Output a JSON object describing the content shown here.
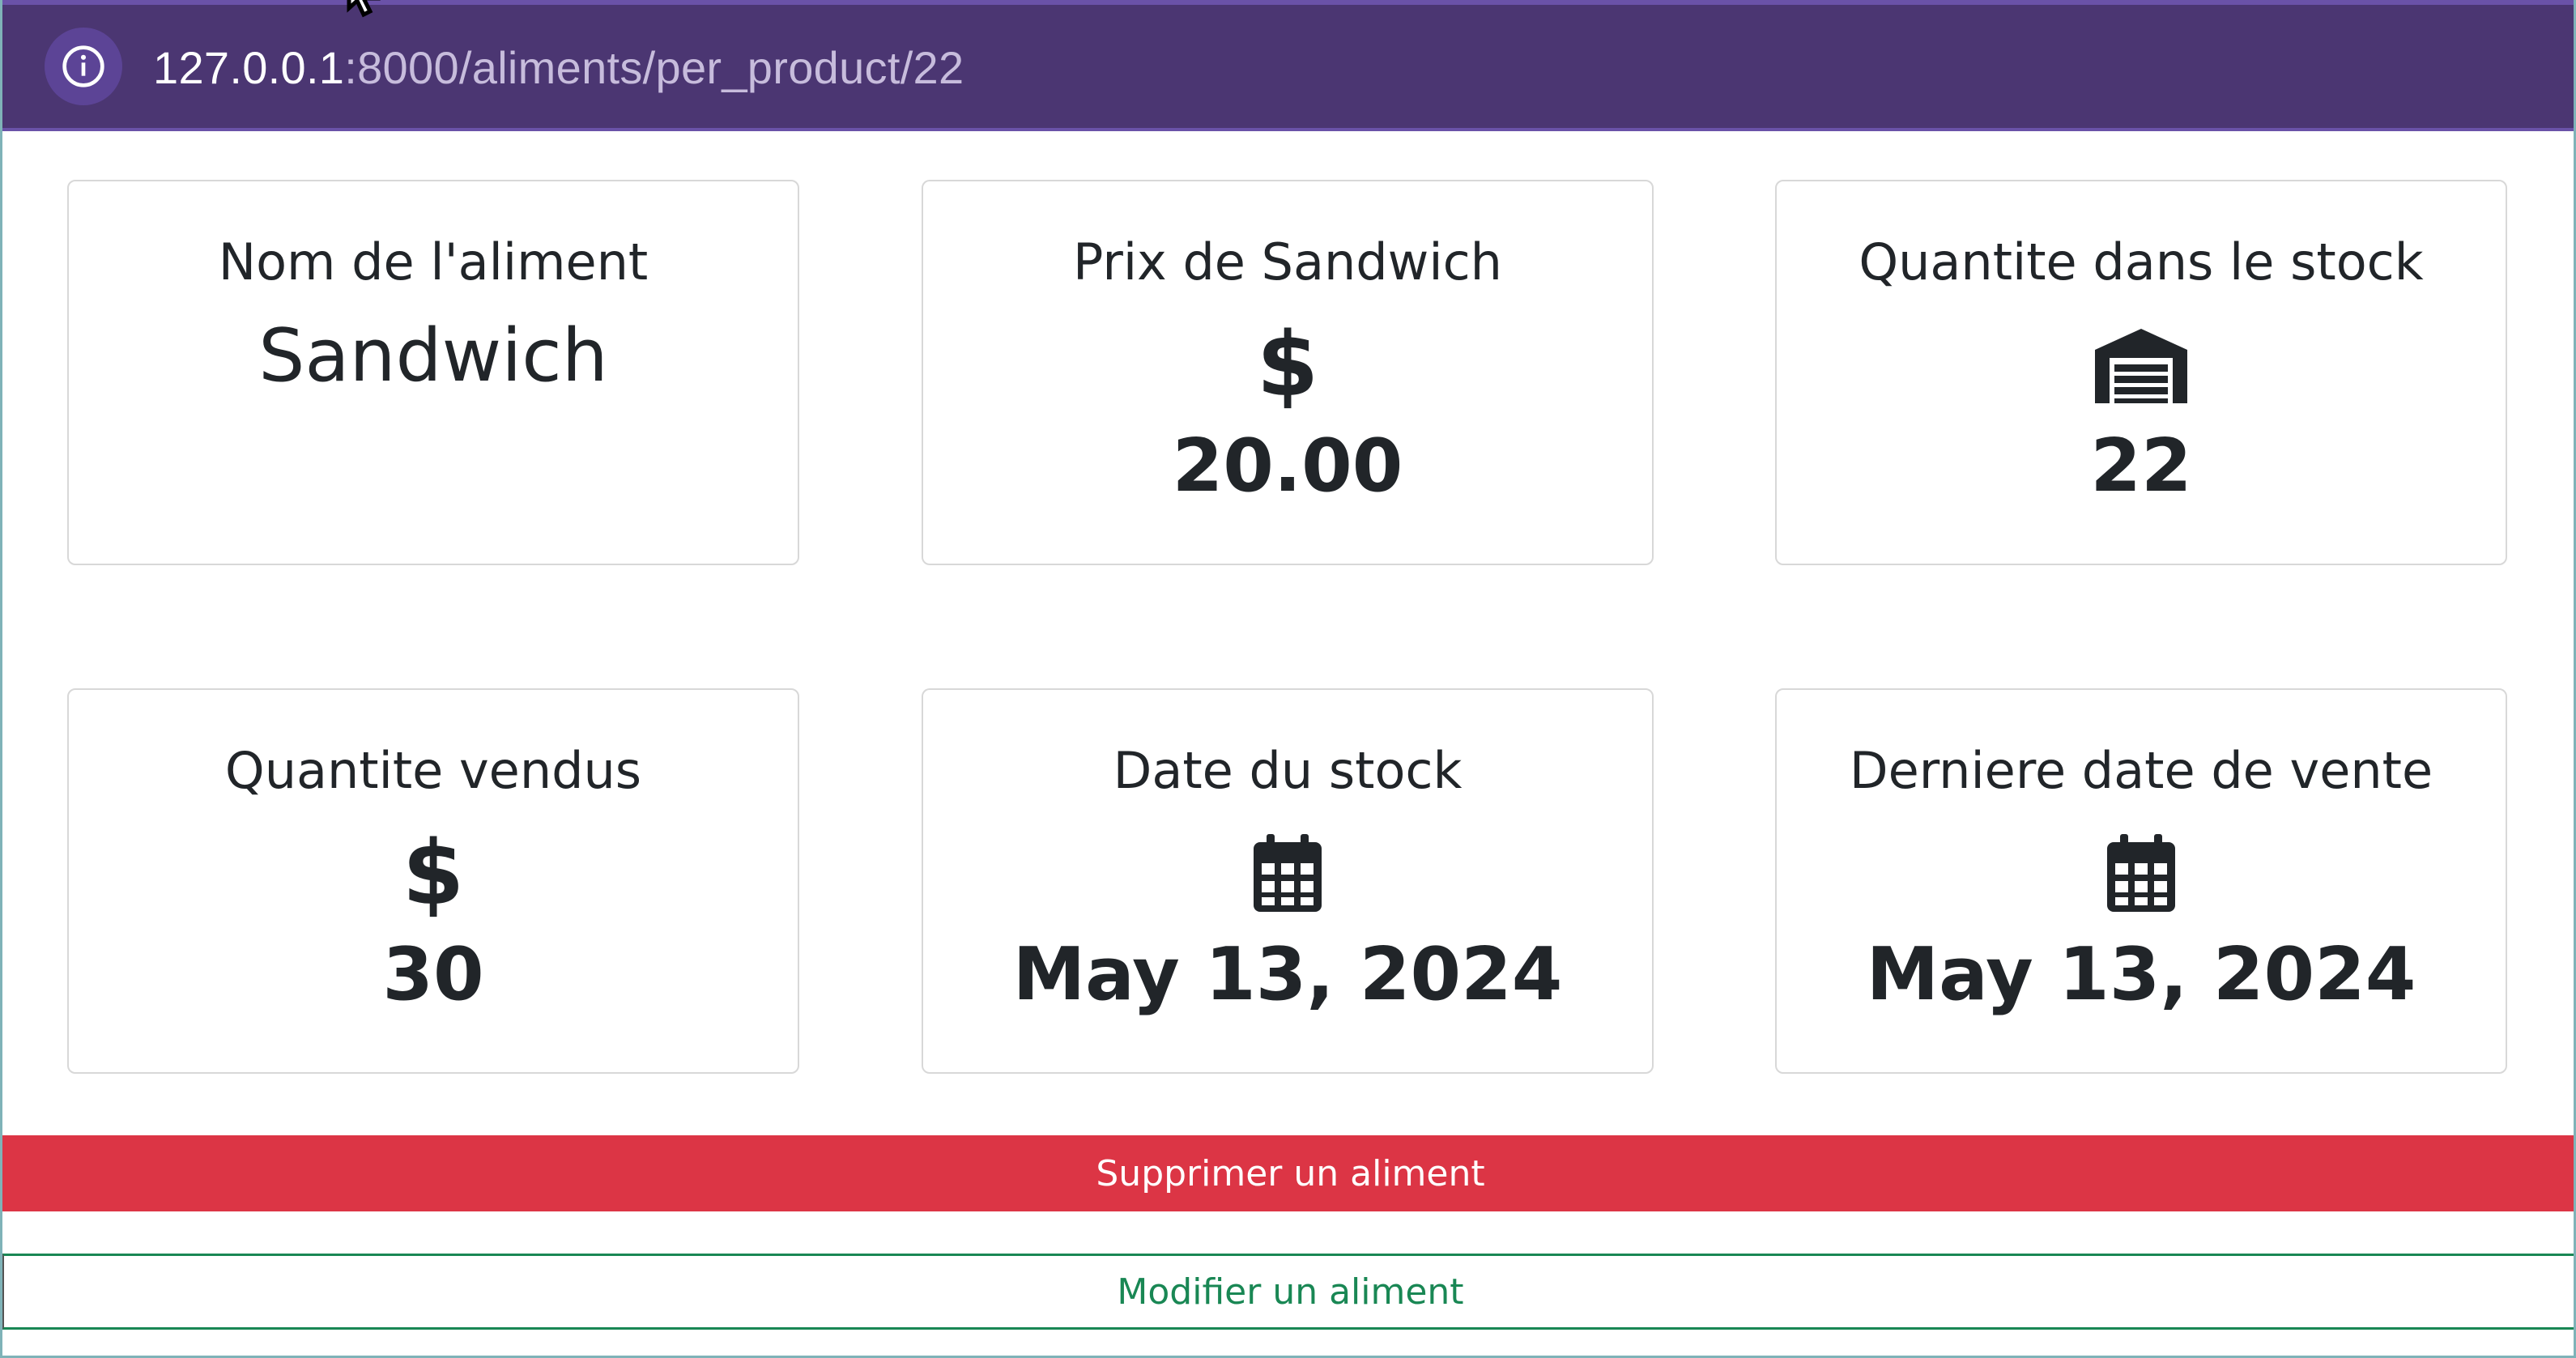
{
  "browser": {
    "url_host": "127.0.0.1",
    "url_path": ":8000/aliments/per_product/22",
    "info_icon": "info-circle-icon"
  },
  "cards": {
    "name": {
      "title": "Nom de l'aliment",
      "value": "Sandwich"
    },
    "price": {
      "title": "Prix de Sandwich",
      "icon": "dollar-icon",
      "value": "20.00"
    },
    "stock": {
      "title": "Quantite dans le stock",
      "icon": "warehouse-icon",
      "value": "22"
    },
    "sold": {
      "title": "Quantite vendus",
      "icon": "dollar-icon",
      "value": "30"
    },
    "stock_date": {
      "title": "Date du stock",
      "icon": "calendar-icon",
      "value": "May 13, 2024"
    },
    "last_sale": {
      "title": "Derniere date de vente",
      "icon": "calendar-icon",
      "value": "May 13, 2024"
    }
  },
  "actions": {
    "delete_label": "Supprimer un aliment",
    "edit_label": "Modifier un aliment"
  },
  "colors": {
    "address_bar": "#4b3672",
    "danger": "#dc3545",
    "success": "#198754",
    "text": "#212529"
  }
}
